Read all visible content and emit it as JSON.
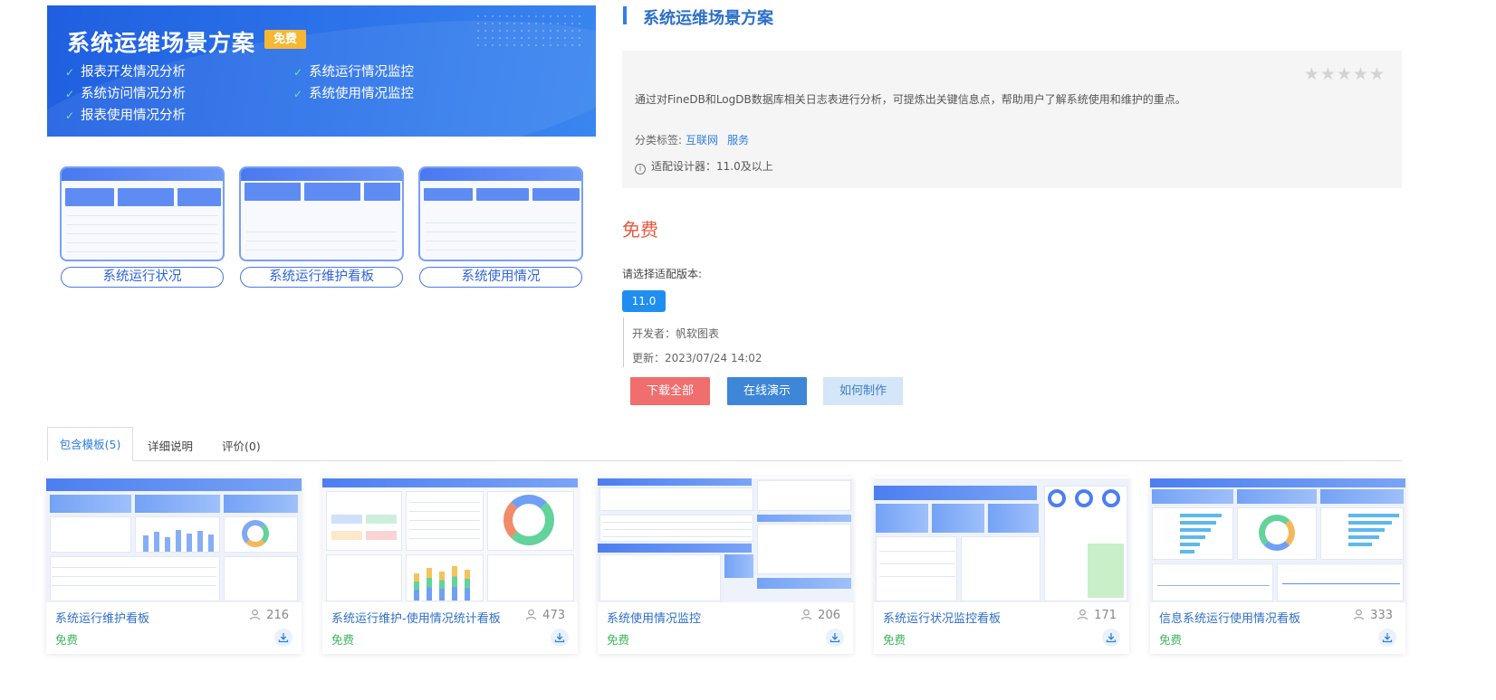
{
  "hero": {
    "title": "系统运维场景方案",
    "badge": "免费",
    "features": [
      "报表开发情况分析",
      "系统运行情况监控",
      "系统访问情况分析",
      "系统使用情况监控",
      "报表使用情况分析"
    ],
    "previews": [
      "系统运行状况",
      "系统运行维护看板",
      "系统使用情况"
    ]
  },
  "detail": {
    "title": "系统运维场景方案",
    "rating_stars": "★★★★★",
    "description": "通过对FineDB和LogDB数据库相关日志表进行分析，可提炼出关键信息点，帮助用户了解系统使用和维护的重点。",
    "tags_label": "分类标签:",
    "tags": [
      "互联网",
      "服务"
    ],
    "compat_label": "适配设计器：11.0及以上",
    "price": "免费",
    "version_label": "请选择适配版本:",
    "version": "11.0",
    "developer": "开发者：帆软图表",
    "updated": "更新：2023/07/24 14:02",
    "actions": {
      "download_all": "下载全部",
      "online_demo": "在线演示",
      "how_to_make": "如何制作"
    }
  },
  "tabs": [
    {
      "label": "包含模板(5)",
      "active": true
    },
    {
      "label": "详细说明",
      "active": false
    },
    {
      "label": "评价(0)",
      "active": false
    }
  ],
  "templates": [
    {
      "name": "系统运行维护看板",
      "count": "216",
      "price": "免费"
    },
    {
      "name": "系统运行维护-使用情况统计看板",
      "count": "473",
      "price": "免费"
    },
    {
      "name": "系统使用情况监控",
      "count": "206",
      "price": "免费"
    },
    {
      "name": "系统运行状况监控看板",
      "count": "171",
      "price": "免费"
    },
    {
      "name": "信息系统运行使用情况看板",
      "count": "333",
      "price": "免费"
    }
  ],
  "colors": {
    "accent": "#2f7ee2",
    "price": "#e9583e",
    "download": "#f06e6e",
    "demo": "#3d86d8",
    "free": "#3bb75a"
  },
  "icons": {
    "check": "check-icon",
    "info": "info-icon",
    "user": "user-icon",
    "download": "download-icon",
    "star": "star-icon"
  }
}
